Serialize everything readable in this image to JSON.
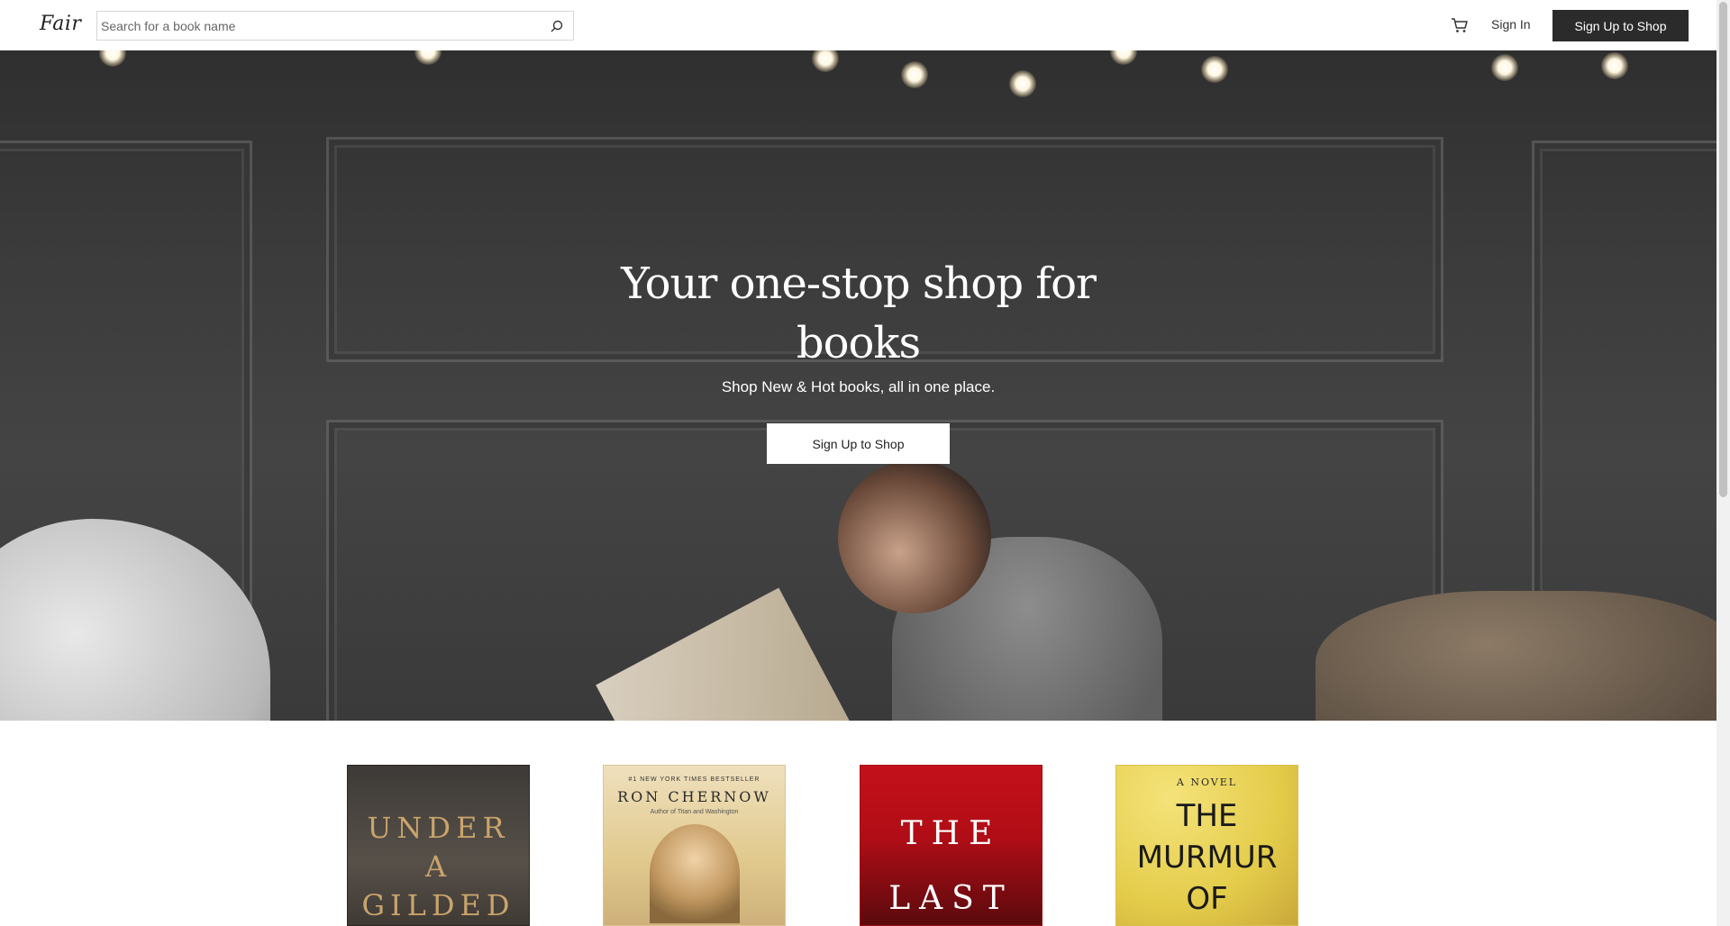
{
  "header": {
    "logo": "Fair",
    "search_placeholder": "Search for a book name",
    "sign_in": "Sign In",
    "sign_up": "Sign Up to Shop"
  },
  "hero": {
    "title": "Your one-stop shop for books",
    "subtitle": "Shop New & Hot books, all in one place.",
    "cta": "Sign Up to Shop"
  },
  "books": [
    {
      "title_lines": [
        "UNDER",
        "A",
        "GILDED"
      ]
    },
    {
      "kicker": "#1 NEW YORK TIMES BESTSELLER",
      "author": "RON CHERNOW",
      "subline": "Author of Titan and Washington"
    },
    {
      "title_lines": [
        "THE",
        "LAST"
      ]
    },
    {
      "kicker": "A NOVEL",
      "title_lines": [
        "THE",
        "MURMUR",
        "OF"
      ]
    }
  ],
  "colors": {
    "accent_dark": "#2b2b2b",
    "book_red": "#c4101a",
    "book_yellow": "#e4cc4a"
  }
}
